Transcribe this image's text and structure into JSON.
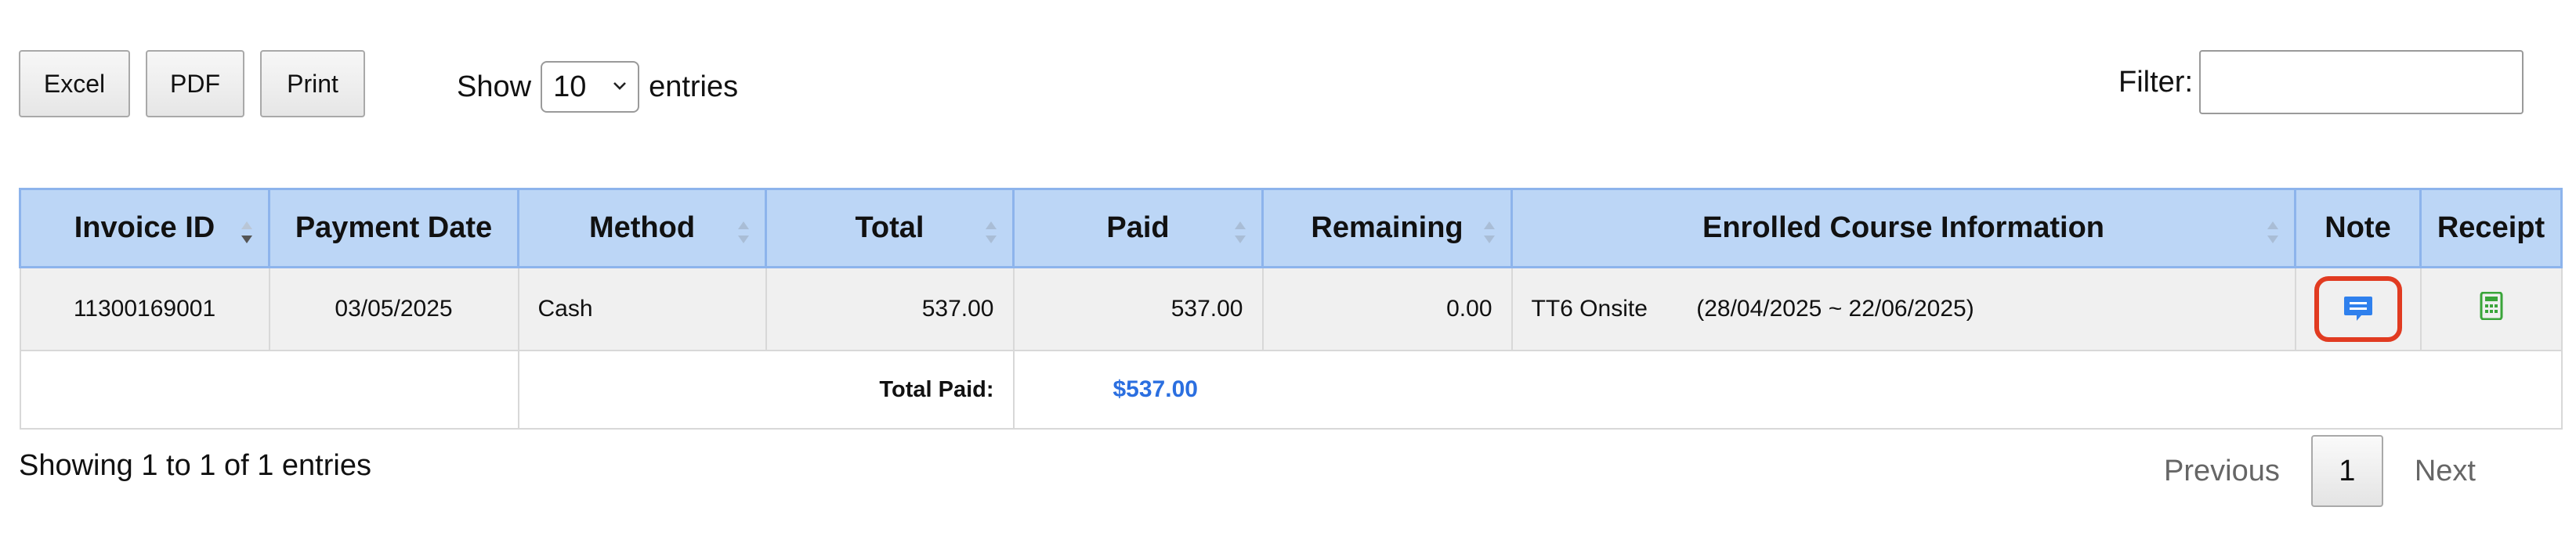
{
  "toolbar": {
    "excel_label": "Excel",
    "pdf_label": "PDF",
    "print_label": "Print"
  },
  "length": {
    "show_label": "Show",
    "selected": "10",
    "entries_label": "entries"
  },
  "filter": {
    "label": "Filter:",
    "value": ""
  },
  "table": {
    "headers": {
      "invoice_id": "Invoice ID",
      "payment_date": "Payment Date",
      "method": "Method",
      "total": "Total",
      "paid": "Paid",
      "remaining": "Remaining",
      "course_info": "Enrolled Course Information",
      "note": "Note",
      "receipt": "Receipt"
    },
    "rows": [
      {
        "invoice_id": "11300169001",
        "payment_date": "03/05/2025",
        "method": "Cash",
        "total": "537.00",
        "paid": "537.00",
        "remaining": "0.00",
        "course_name": "TT6 Onsite",
        "course_dates": "(28/04/2025 ~ 22/06/2025)"
      }
    ],
    "footer": {
      "total_paid_label": "Total Paid:",
      "total_paid_value": "$537.00"
    }
  },
  "info": {
    "text": "Showing 1 to 1 of 1 entries"
  },
  "pagination": {
    "previous": "Previous",
    "current_page": "1",
    "next": "Next"
  },
  "icons": {
    "note": "chat-bubble-icon",
    "receipt": "calculator-icon",
    "sort": "sort-icon"
  },
  "colors": {
    "header_bg": "#bcd6f6",
    "header_border": "#8db4ec",
    "total_paid_value": "#2b6fe0",
    "note_highlight": "#e13b21",
    "note_icon": "#2f80ed",
    "receipt_icon": "#3aa53a"
  }
}
